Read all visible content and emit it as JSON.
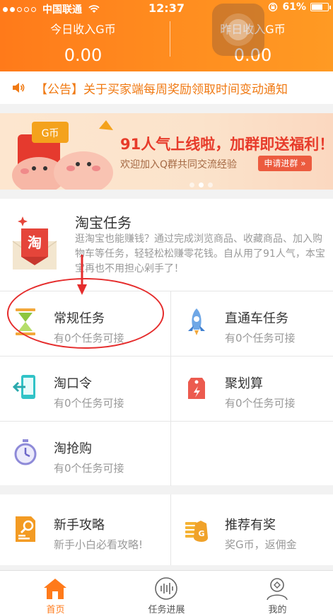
{
  "status_bar": {
    "carrier": "中国联通",
    "time": "12:37",
    "battery": "61%"
  },
  "income": {
    "today_label": "今日收入G币",
    "today_value": "0.00",
    "yesterday_label": "昨日收入G币",
    "yesterday_value": "0.00"
  },
  "notice": {
    "icon": "speaker-icon",
    "text": "【公告】关于买家端每周奖励领取时间变动通知"
  },
  "banner": {
    "headline": "91人气上线啦，加群即送福利！",
    "subline": "欢迎加入Q群共同交流经验",
    "cta": "申请进群 »",
    "coin_label": "G币",
    "active_dot": 1,
    "dot_count": 3
  },
  "taobao_intro": {
    "title": "淘宝任务",
    "description": "逛淘宝也能赚钱？通过完成浏览商品、收藏商品、加入购物车等任务，轻轻松松赚零花钱。自从用了91人气，本宝宝再也不用担心剁手了！",
    "badge": "淘"
  },
  "tasks": [
    {
      "name": "常规任务",
      "sub": "有0个任务可接",
      "icon": "hourglass-icon"
    },
    {
      "name": "直通车任务",
      "sub": "有0个任务可接",
      "icon": "rocket-icon"
    },
    {
      "name": "淘口令",
      "sub": "有0个任务可接",
      "icon": "phone-exit-icon"
    },
    {
      "name": "聚划算",
      "sub": "有0个任务可接",
      "icon": "tag-icon"
    },
    {
      "name": "淘抢购",
      "sub": "有0个任务可接",
      "icon": "stopwatch-icon"
    }
  ],
  "guides": [
    {
      "name": "新手攻略",
      "sub": "新手小白必看攻略!",
      "icon": "guide-doc-icon"
    },
    {
      "name": "推荐有奖",
      "sub": "奖G币，返佣金",
      "icon": "coin-bag-icon",
      "badge": "G"
    }
  ],
  "tabbar": [
    {
      "label": "首页",
      "icon": "home-icon",
      "active": true
    },
    {
      "label": "任务进展",
      "icon": "progress-icon",
      "active": false
    },
    {
      "label": "我的",
      "icon": "profile-icon",
      "active": false
    }
  ],
  "colors": {
    "brand_orange": "#ff7a1a",
    "annotation_red": "#e52c2c",
    "notice_orange": "#f07a14"
  }
}
